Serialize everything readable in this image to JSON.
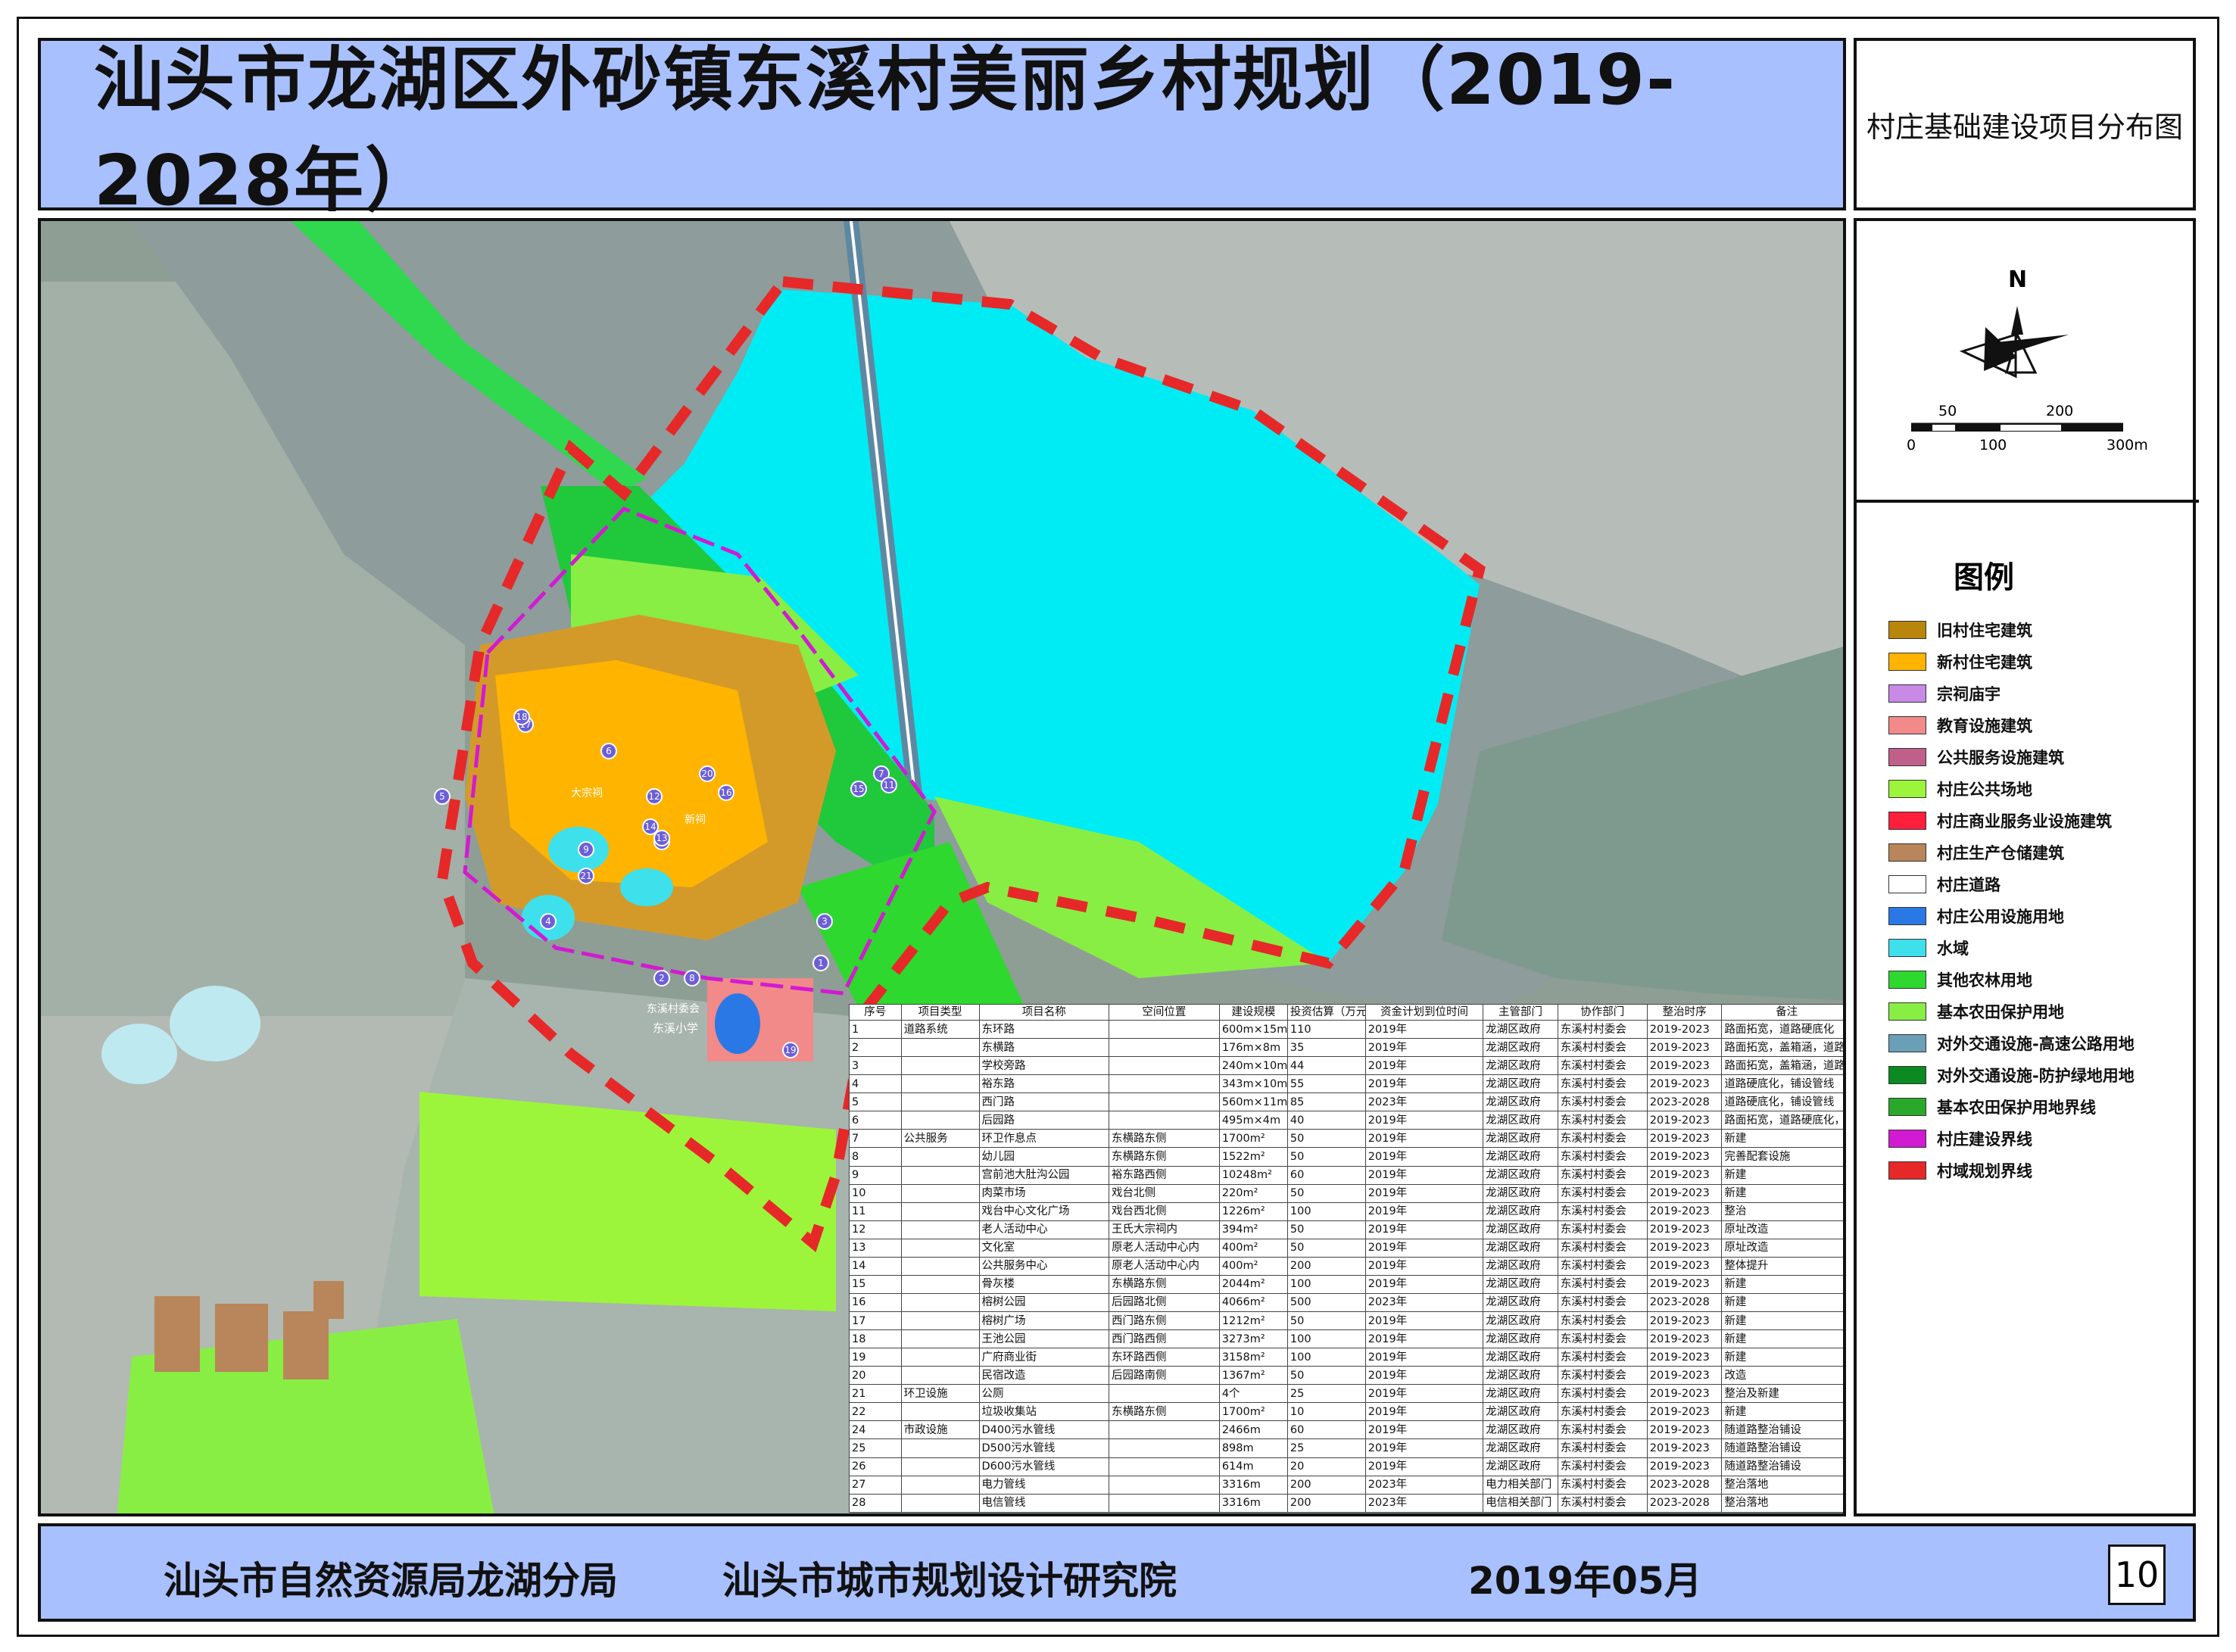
{
  "title": "汕头市龙湖区外砂镇东溪村美丽乡村规划（2019-2028年）",
  "sheet_title": "村庄基础建设项目分布图",
  "north_label": "N",
  "scale_bar": {
    "labels_top": [
      "50",
      "200"
    ],
    "labels_bottom": [
      "0",
      "100",
      "300m"
    ]
  },
  "legend": {
    "title": "图例",
    "items": [
      {
        "label": "旧村住宅建筑",
        "color": "#b8860b"
      },
      {
        "label": "新村住宅建筑",
        "color": "#ffb400"
      },
      {
        "label": "宗祠庙宇",
        "color": "#c88ae6"
      },
      {
        "label": "教育设施建筑",
        "color": "#f28a8a"
      },
      {
        "label": "公共服务设施建筑",
        "color": "#c0608a"
      },
      {
        "label": "村庄公共场地",
        "color": "#9cf53a"
      },
      {
        "label": "村庄商业服务业设施建筑",
        "color": "#ff1e3c"
      },
      {
        "label": "村庄生产仓储建筑",
        "color": "#b8865a"
      },
      {
        "label": "村庄道路",
        "color": "#ffffff"
      },
      {
        "label": "村庄公用设施用地",
        "color": "#2a78e6"
      },
      {
        "label": "水域",
        "color": "#3ee0ec"
      },
      {
        "label": "其他农林用地",
        "color": "#2ed82e"
      },
      {
        "label": "基本农田保护用地",
        "color": "#88ee44"
      },
      {
        "label": "对外交通设施-高速公路用地",
        "color": "#6a9fb8"
      },
      {
        "label": "对外交通设施-防护绿地用地",
        "color": "#0a8a20"
      },
      {
        "label": "基本农田保护用地界线",
        "color": "#2aa82a"
      },
      {
        "label": "村庄建设界线",
        "color": "#d21ad2"
      },
      {
        "label": "村域规划界线",
        "color": "#e62828"
      }
    ]
  },
  "map_labels": [
    {
      "text": "东溪小学"
    },
    {
      "text": "东溪村委会"
    },
    {
      "text": "大宗祠"
    },
    {
      "text": "新祠"
    }
  ],
  "map_markers": [
    "1",
    "2",
    "3",
    "4",
    "5",
    "6",
    "7",
    "8",
    "9",
    "10",
    "11",
    "12",
    "13",
    "14",
    "15",
    "16",
    "17",
    "18",
    "19",
    "20",
    "21"
  ],
  "table": {
    "headers": [
      "序号",
      "项目类型",
      "项目名称",
      "空间位置",
      "建设规模",
      "投资估算（万元）",
      "资金计划到位时间",
      "主管部门",
      "协作部门",
      "整治时序",
      "备注"
    ],
    "rows": [
      [
        "1",
        "道路系统",
        "东环路",
        "",
        "600m×15m",
        "110",
        "2019年",
        "龙湖区政府",
        "东溪村村委会",
        "2019-2023",
        "路面拓宽，道路硬底化"
      ],
      [
        "2",
        "",
        "东横路",
        "",
        "176m×8m",
        "35",
        "2019年",
        "龙湖区政府",
        "东溪村村委会",
        "2019-2023",
        "路面拓宽，盖箱涵，道路硬底化"
      ],
      [
        "3",
        "",
        "学校旁路",
        "",
        "240m×10m",
        "44",
        "2019年",
        "龙湖区政府",
        "东溪村村委会",
        "2019-2023",
        "路面拓宽，盖箱涵，道路硬底化"
      ],
      [
        "4",
        "",
        "裕东路",
        "",
        "343m×10m",
        "55",
        "2019年",
        "龙湖区政府",
        "东溪村村委会",
        "2019-2023",
        "道路硬底化，铺设管线"
      ],
      [
        "5",
        "",
        "西门路",
        "",
        "560m×11m",
        "85",
        "2023年",
        "龙湖区政府",
        "东溪村村委会",
        "2023-2028",
        "道路硬底化，铺设管线"
      ],
      [
        "6",
        "",
        "后园路",
        "",
        "495m×4m",
        "40",
        "2019年",
        "龙湖区政府",
        "东溪村村委会",
        "2019-2023",
        "路面拓宽，道路硬底化，沟渠铺设石篦"
      ],
      [
        "7",
        "公共服务",
        "环卫作息点",
        "东横路东侧",
        "1700m²",
        "50",
        "2019年",
        "龙湖区政府",
        "东溪村村委会",
        "2019-2023",
        "新建"
      ],
      [
        "8",
        "",
        "幼儿园",
        "东横路东侧",
        "1522m²",
        "50",
        "2019年",
        "龙湖区政府",
        "东溪村村委会",
        "2019-2023",
        "完善配套设施"
      ],
      [
        "9",
        "",
        "宫前池大肚沟公园",
        "裕东路西侧",
        "10248m²",
        "60",
        "2019年",
        "龙湖区政府",
        "东溪村村委会",
        "2019-2023",
        "新建"
      ],
      [
        "10",
        "",
        "肉菜市场",
        "戏台北侧",
        "220m²",
        "50",
        "2019年",
        "龙湖区政府",
        "东溪村村委会",
        "2019-2023",
        "新建"
      ],
      [
        "11",
        "",
        "戏台中心文化广场",
        "戏台西北侧",
        "1226m²",
        "100",
        "2019年",
        "龙湖区政府",
        "东溪村村委会",
        "2019-2023",
        "整治"
      ],
      [
        "12",
        "",
        "老人活动中心",
        "王氏大宗祠内",
        "394m²",
        "50",
        "2019年",
        "龙湖区政府",
        "东溪村村委会",
        "2019-2023",
        "原址改造"
      ],
      [
        "13",
        "",
        "文化室",
        "原老人活动中心内",
        "400m²",
        "50",
        "2019年",
        "龙湖区政府",
        "东溪村村委会",
        "2019-2023",
        "原址改造"
      ],
      [
        "14",
        "",
        "公共服务中心",
        "原老人活动中心内",
        "400m²",
        "200",
        "2019年",
        "龙湖区政府",
        "东溪村村委会",
        "2019-2023",
        "整体提升"
      ],
      [
        "15",
        "",
        "骨灰楼",
        "东横路东侧",
        "2044m²",
        "100",
        "2019年",
        "龙湖区政府",
        "东溪村村委会",
        "2019-2023",
        "新建"
      ],
      [
        "16",
        "",
        "榕树公园",
        "后园路北侧",
        "4066m²",
        "500",
        "2023年",
        "龙湖区政府",
        "东溪村村委会",
        "2023-2028",
        "新建"
      ],
      [
        "17",
        "",
        "榕树广场",
        "西门路东侧",
        "1212m²",
        "50",
        "2019年",
        "龙湖区政府",
        "东溪村村委会",
        "2019-2023",
        "新建"
      ],
      [
        "18",
        "",
        "王池公园",
        "西门路西侧",
        "3273m²",
        "100",
        "2019年",
        "龙湖区政府",
        "东溪村村委会",
        "2019-2023",
        "新建"
      ],
      [
        "19",
        "",
        "广府商业街",
        "东环路西侧",
        "3158m²",
        "100",
        "2019年",
        "龙湖区政府",
        "东溪村村委会",
        "2019-2023",
        "新建"
      ],
      [
        "20",
        "",
        "民宿改造",
        "后园路南侧",
        "1367m²",
        "50",
        "2019年",
        "龙湖区政府",
        "东溪村村委会",
        "2019-2023",
        "改造"
      ],
      [
        "21",
        "环卫设施",
        "公厕",
        "",
        "4个",
        "25",
        "2019年",
        "龙湖区政府",
        "东溪村村委会",
        "2019-2023",
        "整治及新建"
      ],
      [
        "22",
        "",
        "垃圾收集站",
        "东横路东侧",
        "1700m²",
        "10",
        "2019年",
        "龙湖区政府",
        "东溪村村委会",
        "2019-2023",
        "新建"
      ],
      [
        "24",
        "市政设施",
        "D400污水管线",
        "",
        "2466m",
        "60",
        "2019年",
        "龙湖区政府",
        "东溪村村委会",
        "2019-2023",
        "随道路整治铺设"
      ],
      [
        "25",
        "",
        "D500污水管线",
        "",
        "898m",
        "25",
        "2019年",
        "龙湖区政府",
        "东溪村村委会",
        "2019-2023",
        "随道路整治铺设"
      ],
      [
        "26",
        "",
        "D600污水管线",
        "",
        "614m",
        "20",
        "2019年",
        "龙湖区政府",
        "东溪村村委会",
        "2019-2023",
        "随道路整治铺设"
      ],
      [
        "27",
        "",
        "电力管线",
        "",
        "3316m",
        "200",
        "2023年",
        "电力相关部门",
        "东溪村村委会",
        "2023-2028",
        "整治落地"
      ],
      [
        "28",
        "",
        "电信管线",
        "",
        "3316m",
        "200",
        "2023年",
        "电信相关部门",
        "东溪村村委会",
        "2023-2028",
        "整治落地"
      ]
    ]
  },
  "footer": {
    "org1": "汕头市自然资源局龙湖分局",
    "org2": "汕头市城市规划设计研究院",
    "date": "2019年05月",
    "page": "10"
  }
}
